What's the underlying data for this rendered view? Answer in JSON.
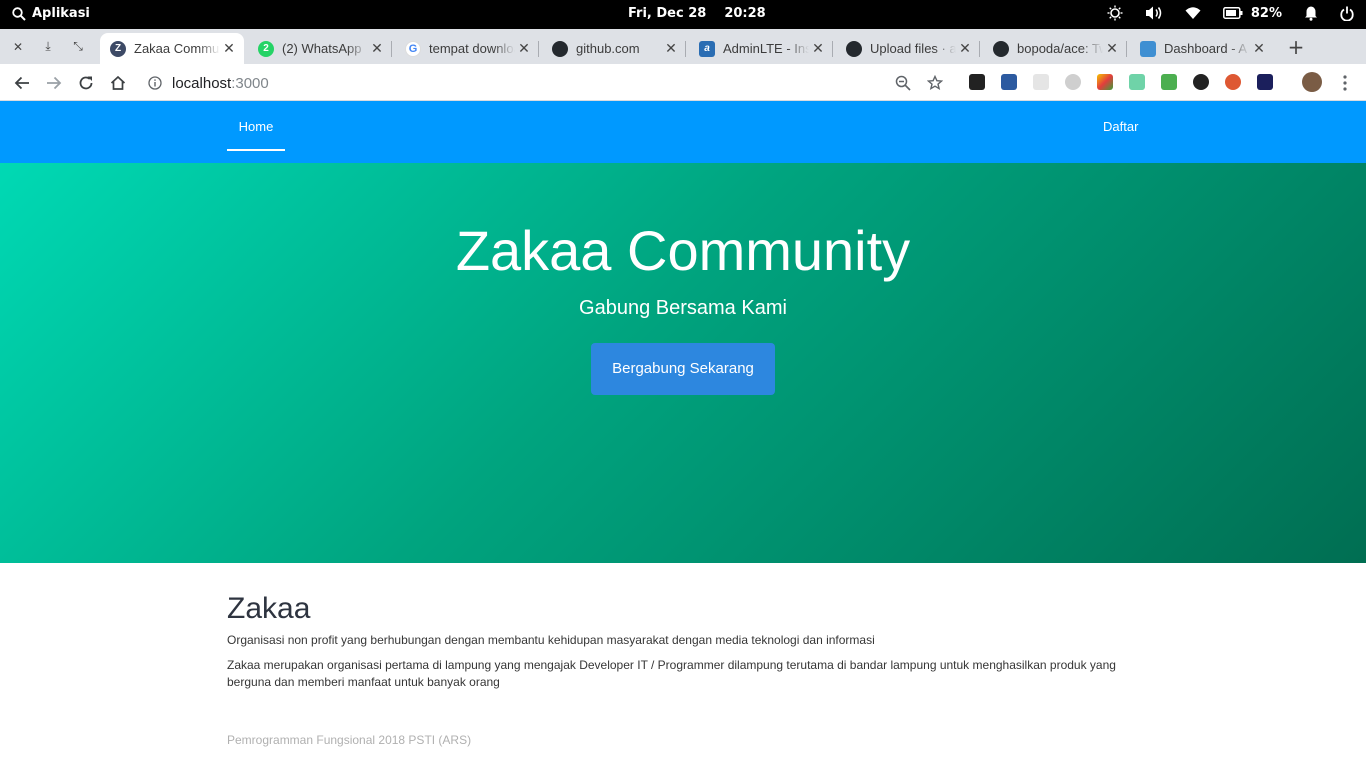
{
  "system_bar": {
    "apps_label": "Aplikasi",
    "date": "Fri, Dec 28",
    "time": "20:28",
    "battery": "82%"
  },
  "browser": {
    "tabs": [
      {
        "title": "Zakaa Community",
        "active": true,
        "icon": "zakaa-favicon",
        "color": "#3d4a66"
      },
      {
        "title": "(2) WhatsApp",
        "active": false,
        "icon": "whatsapp-favicon",
        "color": "#25d366"
      },
      {
        "title": "tempat download",
        "active": false,
        "icon": "google-favicon",
        "color": "#ffffff"
      },
      {
        "title": "github.com",
        "active": false,
        "icon": "github-favicon",
        "color": "#24292e"
      },
      {
        "title": "AdminLTE - Ins",
        "active": false,
        "icon": "adminlte-favicon",
        "color": "#2a6db3"
      },
      {
        "title": "Upload files · a",
        "active": false,
        "icon": "github-favicon",
        "color": "#24292e"
      },
      {
        "title": "bopoda/ace: Tw",
        "active": false,
        "icon": "github-favicon",
        "color": "#24292e"
      },
      {
        "title": "Dashboard - A",
        "active": false,
        "icon": "dashboard-favicon",
        "color": "#3f8fd2"
      }
    ],
    "url_host": "localhost",
    "url_port": ":3000"
  },
  "page": {
    "nav": {
      "home": "Home",
      "daftar": "Daftar"
    },
    "hero": {
      "title": "Zakaa Community",
      "subtitle": "Gabung Bersama Kami",
      "cta": "Bergabung Sekarang"
    },
    "about": {
      "heading": "Zakaa",
      "p1": "Organisasi non profit yang berhubungan dengan membantu kehidupan masyarakat dengan media teknologi dan informasi",
      "p2": "Zakaa merupakan organisasi pertama di lampung yang mengajak Developer IT / Programmer dilampung terutama di bandar lampung untuk menghasilkan produk yang berguna dan memberi manfaat untuk banyak orang"
    },
    "footer": "Pemrogramman Fungsional 2018 PSTI (ARS)"
  },
  "colors": {
    "nav_bg": "#0099ff",
    "hero_start": "#00d9b4",
    "hero_end": "#006e52",
    "cta_bg": "#2d87df"
  }
}
